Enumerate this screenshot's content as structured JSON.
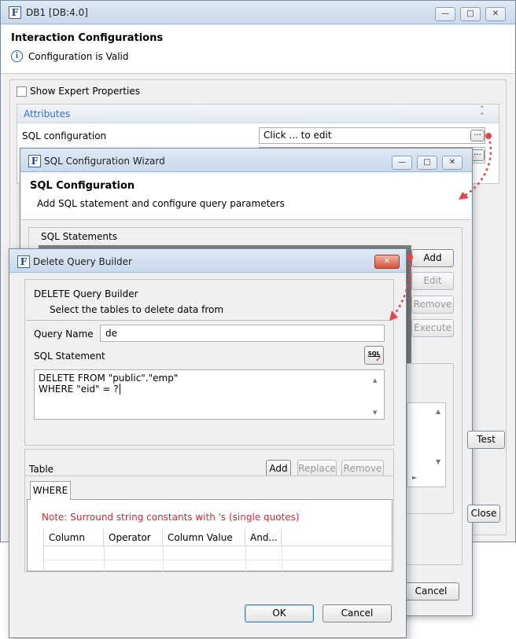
{
  "main_window": {
    "title": "DB1 [DB:4.0]",
    "heading": "Interaction Configurations",
    "status": "Configuration is Valid",
    "show_expert_label": "Show Expert Properties",
    "attributes_header": "Attributes",
    "sql_config_label": "SQL configuration",
    "sql_config_value": "Click ... to edit",
    "ellipsis": "...",
    "test_label": "Test",
    "close_label": "Close"
  },
  "wizard": {
    "title": "SQL Configuration Wizard",
    "heading": "SQL Configuration",
    "subheading": "Add SQL statement and configure query parameters",
    "statements_label": "SQL Statements",
    "add_label": "Add",
    "edit_label": "Edit",
    "remove_label": "Remove",
    "execute_label": "Execute",
    "cancel_label": "Cancel"
  },
  "builder": {
    "title": "Delete Query Builder",
    "heading": "DELETE Query Builder",
    "subheading": "Select the tables to delete data from",
    "query_name_label": "Query Name",
    "query_name_value": "de",
    "sql_statement_label": "SQL Statement",
    "sql_icon_text": "SQL",
    "sql_line1": "DELETE FROM \"public\".\"emp\"",
    "sql_line2": "WHERE \"eid\" = ?",
    "table_label": "Table",
    "add_label": "Add",
    "replace_label": "Replace",
    "remove_label": "Remove",
    "where_tab": "WHERE",
    "note": "Note: Surround string constants with 's (single quotes)",
    "columns": [
      "Column",
      "Operator",
      "Column Value",
      "And..."
    ],
    "ok_label": "OK",
    "cancel_label": "Cancel"
  },
  "colors": {
    "link_blue": "#3b6fc4",
    "note_red": "#d9262c",
    "arrow_red": "#e0474c"
  }
}
